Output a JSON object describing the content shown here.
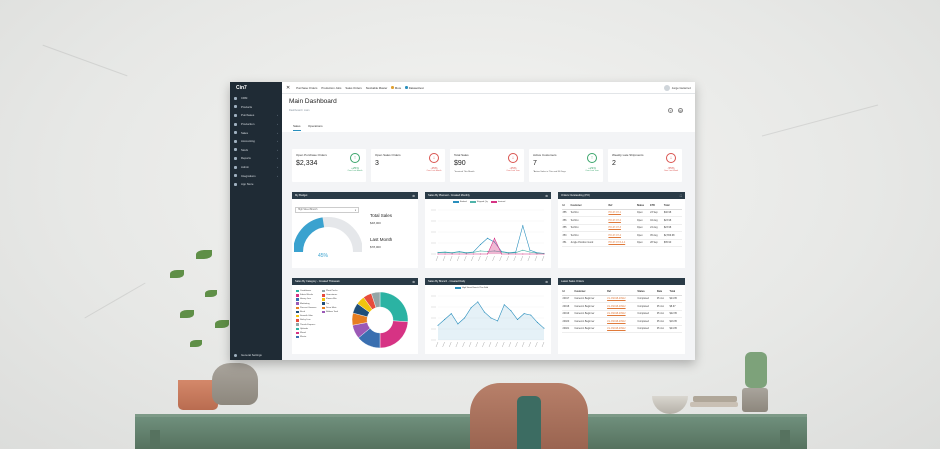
{
  "colors": {
    "sidebar": "#1f2b35",
    "panel_header": "#2a3b47",
    "accent": "#2a8fbd",
    "up": "#3aa56b",
    "down": "#d9534f",
    "link": "#e07a3a"
  },
  "app": {
    "logo": "Cin7"
  },
  "sidebar": {
    "items": [
      {
        "label": "CRM",
        "icon": "crm-icon",
        "chevron": false
      },
      {
        "label": "Products",
        "icon": "products-icon",
        "chevron": false
      },
      {
        "label": "Purchases",
        "icon": "cart-icon",
        "chevron": true
      },
      {
        "label": "Production",
        "icon": "factory-icon",
        "chevron": true
      },
      {
        "label": "Sales",
        "icon": "sales-icon",
        "chevron": true
      },
      {
        "label": "Accounting",
        "icon": "accounting-icon",
        "chevron": true
      },
      {
        "label": "Stock",
        "icon": "stock-icon",
        "chevron": true
      },
      {
        "label": "Reports",
        "icon": "reports-icon",
        "chevron": true
      },
      {
        "label": "Admin",
        "icon": "admin-icon",
        "chevron": true
      },
      {
        "label": "Integrations",
        "icon": "integrations-icon",
        "chevron": true
      },
      {
        "label": "App Store",
        "icon": "app-store-icon",
        "chevron": false
      }
    ],
    "bottom": "General Settings"
  },
  "topbar": {
    "links": [
      "Purchase Orders",
      "Production Jobs",
      "Sales Orders",
      "Stockable Master"
    ],
    "more": "More",
    "chip": "Dataset/test",
    "user": "Jorge Gutierrez"
  },
  "header": {
    "title": "Main Dashboard",
    "breadcrumb": "Dashboard / main",
    "tabs": [
      "Sales",
      "Operations"
    ]
  },
  "kpis": [
    {
      "title": "Open Purchase Orders",
      "value": "$2,334",
      "sub": "",
      "trend": "up",
      "pct": "+25%",
      "period": "Over Last Month"
    },
    {
      "title": "Open Sales Orders",
      "value": "3",
      "sub": "",
      "trend": "down",
      "pct": "-45%",
      "period": "Over Last Month"
    },
    {
      "title": "Total Sales",
      "value": "$90",
      "sub": "*Invoiced This Month",
      "trend": "down",
      "pct": "-25%",
      "period": "Over Last Year"
    },
    {
      "title": "Active Customers",
      "value": "7",
      "sub": "*Active Sales in This and 30 Days",
      "trend": "up",
      "pct": "+23%",
      "period": "Over Last Year"
    },
    {
      "title": "Weekly Late Shipments",
      "value": "2",
      "sub": "",
      "trend": "down",
      "pct": "-55%",
      "period": "Over Last Week"
    }
  ],
  "budget": {
    "header": "My Budget",
    "select": "High Street Branch",
    "total_sales_label": "Total Sales",
    "total_sales": "$48,000",
    "last_month_label": "Last Month",
    "last_month": "$78,000",
    "gauge_pct": "45%",
    "gauge_value": 0.45
  },
  "sales_planned": {
    "header": "Sales By Planned - Created Monthly",
    "chart_data": {
      "type": "line",
      "series": [
        {
          "name": "Booked",
          "color": "#2a8fbd",
          "values": [
            50,
            60,
            40,
            80,
            40,
            60,
            300,
            500,
            380,
            80,
            40,
            60,
            900,
            120,
            40,
            20
          ]
        },
        {
          "name": "Shipped Qty",
          "color": "#4fb3a9",
          "values": [
            40,
            50,
            35,
            60,
            30,
            50,
            100,
            80,
            100,
            60,
            30,
            40,
            120,
            60,
            30,
            15
          ]
        },
        {
          "name": "Invoiced",
          "color": "#d63384",
          "values": [
            0,
            0,
            0,
            0,
            0,
            0,
            0,
            0,
            500,
            0,
            0,
            0,
            0,
            0,
            0,
            0
          ]
        }
      ],
      "ylim": [
        0,
        1400
      ]
    }
  },
  "orders_outstanding": {
    "header": "Orders Outstanding (PO)",
    "columns": [
      "Id",
      "Customer",
      "Ref",
      "Status",
      "ETD",
      "Total"
    ],
    "rows": [
      [
        "355",
        "TechCo",
        "PO-07-07-1",
        "Open",
        "23 Sep",
        "$40.98"
      ],
      [
        "356",
        "TechCo",
        "PO-07-07-2",
        "Open",
        "04 Aug",
        "$23.98"
      ],
      [
        "355",
        "TechCo",
        "PO-07-07-3",
        "Open",
        "24 Aug",
        "$23.98"
      ],
      [
        "353",
        "TechCo",
        "PO-07-07-4",
        "Open",
        "05 Aug",
        "$2,659.98"
      ],
      [
        "351",
        "Jungle Position Good",
        "PO-07-07-5-4-4",
        "Open",
        "28 Sep",
        "$35.90"
      ]
    ]
  },
  "sales_category": {
    "header": "Sales By Category - Created Thisweek",
    "legend": [
      "Conditioner",
      "Fabric Blocks",
      "Honey Jars",
      "Marketing",
      "Percent Grooves",
      "Rush",
      "Smooth Glue",
      "Sticky Line",
      "Thrash Express",
      "Uploads",
      "Wood",
      "Wusta"
    ],
    "legend2": [
      "Plant Packs",
      "Gemstones",
      "Flower Mix",
      "Tar",
      "Drive Mats",
      "Ribbon Tank"
    ],
    "chart_data": {
      "type": "pie",
      "categories": [
        "Thrash Express",
        "Honey Jars",
        "Uploads",
        "Wood",
        "Marketing",
        "Rush",
        "Fabric Blocks",
        "Conditioner",
        "Other"
      ],
      "values": [
        26,
        24,
        14,
        8,
        7,
        6,
        5,
        5,
        5
      ],
      "colors": [
        "#2bb3a3",
        "#d63384",
        "#3a6fb0",
        "#9b59b6",
        "#e67e22",
        "#1f4e79",
        "#f1c40f",
        "#e74c3c",
        "#95a5a6"
      ]
    }
  },
  "sales_branch": {
    "header": "Sales By Branch - Created Daily",
    "chart_data": {
      "type": "area",
      "series": [
        {
          "name": "High Street Branch Plan Sold",
          "color": "#2a8fbd",
          "values": [
            20,
            28,
            36,
            22,
            30,
            44,
            52,
            38,
            30,
            26,
            48,
            40,
            28,
            36,
            34,
            24,
            16
          ]
        }
      ],
      "ylim": [
        0,
        60
      ]
    }
  },
  "latest_orders": {
    "header": "Latest Sales Orders",
    "columns": [
      "Id",
      "Customer",
      "Ref",
      "Status",
      "Date",
      "Total"
    ],
    "rows": [
      [
        "20017",
        "Cameron Beginner",
        "LS-CS018-20912",
        "Completed",
        "05 Jun",
        "$24.95"
      ],
      [
        "20018",
        "Cameron Beginner",
        "LS-CS018-20912",
        "Completed",
        "05 Jun",
        "$8.97"
      ],
      [
        "20019",
        "Cameron Beginner",
        "LS-CS018-20912",
        "Completed",
        "05 Jun",
        "$22.95"
      ],
      [
        "20020",
        "Cameron Beginner",
        "LS-CS018-20912",
        "Completed",
        "05 Jun",
        "$16.95"
      ],
      [
        "20021",
        "Cameron Beginner",
        "LS-CS018-20912",
        "Completed",
        "05 Jun",
        "$24.95"
      ]
    ]
  }
}
